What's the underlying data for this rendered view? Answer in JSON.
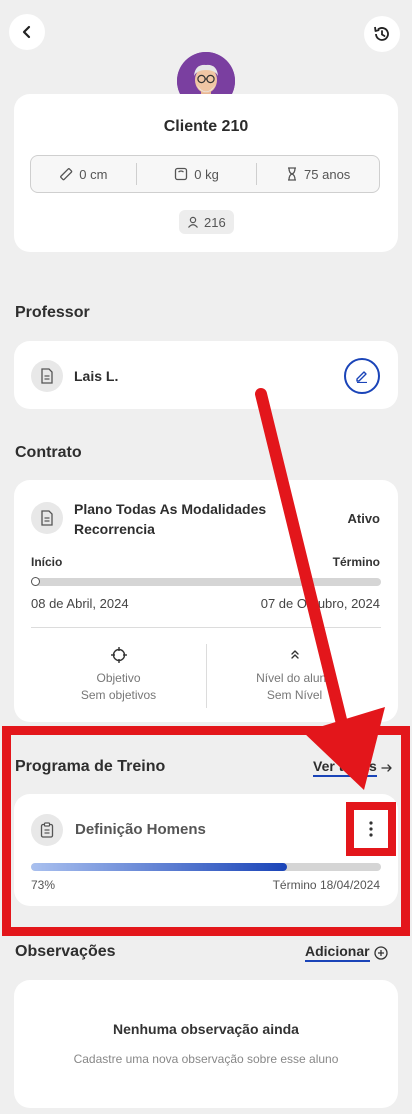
{
  "header": {
    "back_icon": "chevron-left-icon",
    "history_icon": "history-icon"
  },
  "profile": {
    "name": "Cliente 210",
    "height": "0 cm",
    "weight": "0 kg",
    "age": "75 anos",
    "code": "216"
  },
  "professor": {
    "title": "Professor",
    "name": "Lais L."
  },
  "contract": {
    "title": "Contrato",
    "plan_line1": "Plano Todas As Modalidades",
    "plan_line2": "Recorrencia",
    "status": "Ativo",
    "start_label": "Início",
    "end_label": "Término",
    "start_date": "08 de Abril, 2024",
    "end_date": "07 de Outubro, 2024",
    "progress": 0.02,
    "objective_label": "Objetivo",
    "objective_value": "Sem objetivos",
    "level_label": "Nível do aluno",
    "level_value": "Sem Nível"
  },
  "training": {
    "title": "Programa de Treino",
    "see_all": "Ver todos",
    "program_name": "Definição Homens",
    "percent": "73%",
    "progress": 0.73,
    "end_text": "Término 18/04/2024"
  },
  "observations": {
    "title": "Observações",
    "add_label": "Adicionar",
    "empty_title": "Nenhuma observação ainda",
    "empty_subtitle": "Cadastre uma nova observação sobre esse aluno"
  },
  "colors": {
    "accent": "#1a44b8",
    "annotation": "#e3161b",
    "bar_track": "#d5d5d5"
  }
}
